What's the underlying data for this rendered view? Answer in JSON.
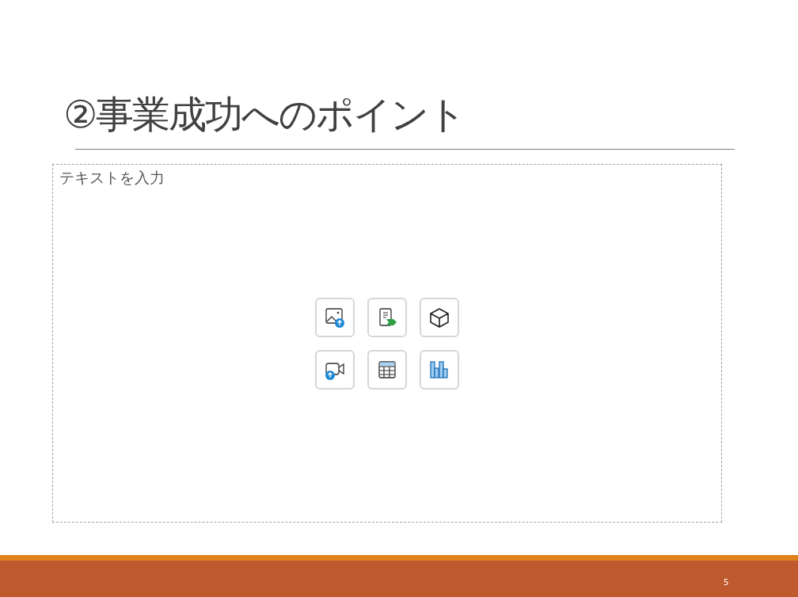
{
  "slide": {
    "title": "②事業成功へのポイント",
    "placeholder": "テキストを入力",
    "page_number": "5"
  },
  "insert_buttons": [
    {
      "kind": "image"
    },
    {
      "kind": "stock"
    },
    {
      "kind": "model"
    },
    {
      "kind": "video"
    },
    {
      "kind": "table"
    },
    {
      "kind": "chart"
    }
  ]
}
